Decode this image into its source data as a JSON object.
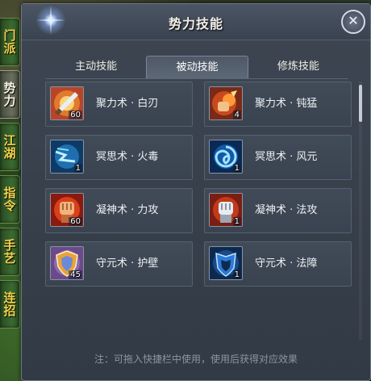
{
  "side_tabs": [
    {
      "label": "门派",
      "active": false
    },
    {
      "label": "势力",
      "active": true
    },
    {
      "label": "江湖",
      "active": false
    },
    {
      "label": "指令",
      "active": false
    },
    {
      "label": "手艺",
      "active": false
    },
    {
      "label": "连招",
      "active": false
    }
  ],
  "panel": {
    "title": "势力技能",
    "close_label": "✕"
  },
  "tabs": [
    {
      "label": "主动技能",
      "active": false
    },
    {
      "label": "被动技能",
      "active": true
    },
    {
      "label": "修炼技能",
      "active": false
    }
  ],
  "skills": [
    {
      "name": "聚力术 · 白刃",
      "level": "60",
      "icon": "sword-icon"
    },
    {
      "name": "聚力术 · 钝猛",
      "level": "4",
      "icon": "fist-strike-icon"
    },
    {
      "name": "冥思术 · 火毒",
      "level": "1",
      "icon": "lightning-icon"
    },
    {
      "name": "冥思术 · 风元",
      "level": "1",
      "icon": "swirl-icon"
    },
    {
      "name": "凝神术 · 力攻",
      "level": "60",
      "icon": "red-fist-icon"
    },
    {
      "name": "凝神术 · 法攻",
      "level": "1",
      "icon": "spell-fist-icon"
    },
    {
      "name": "守元术 · 护壁",
      "level": "45",
      "icon": "shield-icon"
    },
    {
      "name": "守元术 · 法障",
      "level": "1",
      "icon": "blue-shield-icon"
    }
  ],
  "note": "注：可拖入快捷栏中使用，使用后获得对应效果",
  "colors": {
    "panel": "#3a4350",
    "tab_text": "#f0ede4",
    "side_tab_text": "#f3d24a"
  }
}
